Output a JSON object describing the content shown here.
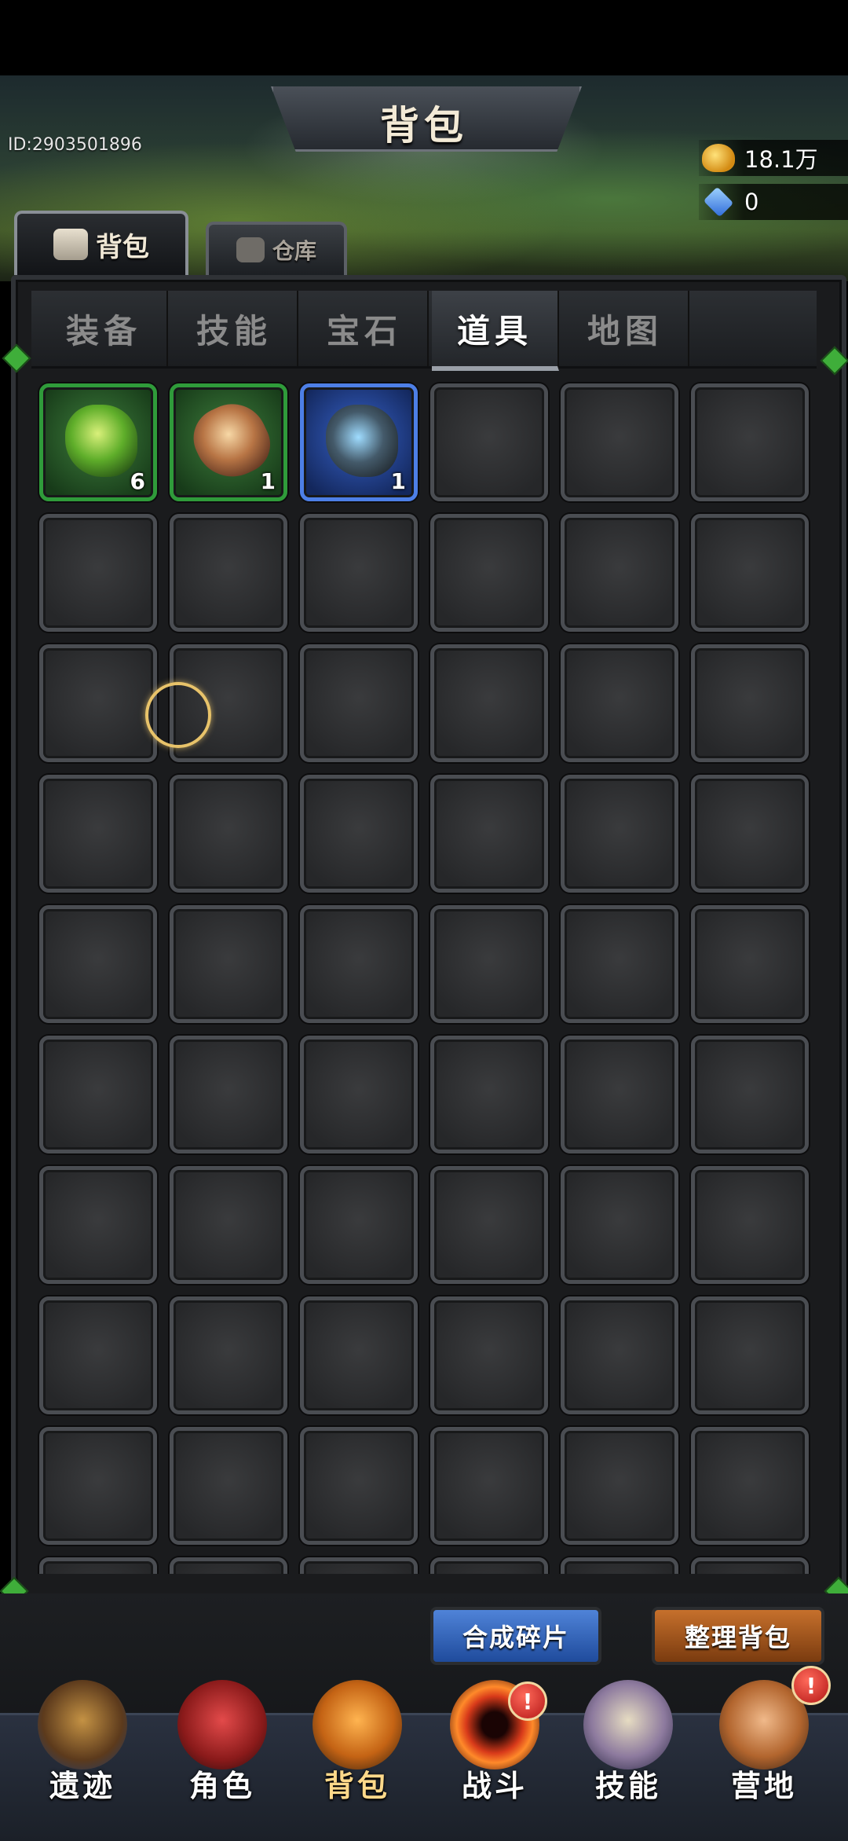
{
  "header": {
    "title": "背包",
    "player_id": "ID:2903501896",
    "resources": [
      {
        "icon": "gold-coins-icon",
        "value": "18.1万"
      },
      {
        "icon": "blue-gem-icon",
        "value": "0"
      }
    ]
  },
  "main_tabs": [
    {
      "label": "背包",
      "icon": "backpack-icon",
      "active": true
    },
    {
      "label": "仓库",
      "icon": "chest-icon",
      "active": false
    }
  ],
  "sub_tabs": [
    {
      "label": "装备",
      "active": false
    },
    {
      "label": "技能",
      "active": false
    },
    {
      "label": "宝石",
      "active": false
    },
    {
      "label": "道具",
      "active": true
    },
    {
      "label": "地图",
      "active": false
    }
  ],
  "inventory": {
    "columns": 6,
    "visible_rows": 10,
    "items": [
      {
        "slot": 0,
        "rarity": "green",
        "icon": "green-ore-icon",
        "count": "6"
      },
      {
        "slot": 1,
        "rarity": "green",
        "icon": "amber-crystal-icon",
        "count": "1"
      },
      {
        "slot": 2,
        "rarity": "blue",
        "icon": "rune-stone-icon",
        "count": "1"
      }
    ]
  },
  "actions": {
    "merge_label": "合成碎片",
    "sort_label": "整理背包"
  },
  "bottom_nav": [
    {
      "label": "遗迹",
      "icon": "ruins-sword-icon",
      "badge": null,
      "active": false
    },
    {
      "label": "角色",
      "icon": "hooded-character-icon",
      "badge": null,
      "active": false
    },
    {
      "label": "背包",
      "icon": "backpack-icon",
      "badge": null,
      "active": true
    },
    {
      "label": "战斗",
      "icon": "vortex-portal-icon",
      "badge": "!",
      "active": false
    },
    {
      "label": "技能",
      "icon": "spellbook-icon",
      "badge": null,
      "active": false
    },
    {
      "label": "营地",
      "icon": "camp-totem-icon",
      "badge": "!",
      "active": false
    }
  ],
  "colors": {
    "rarity_green": "#2f9b3a",
    "rarity_blue": "#4d7fe6",
    "merge_button": "#2f63bd",
    "sort_button": "#a85420",
    "badge_red": "#d42020"
  }
}
